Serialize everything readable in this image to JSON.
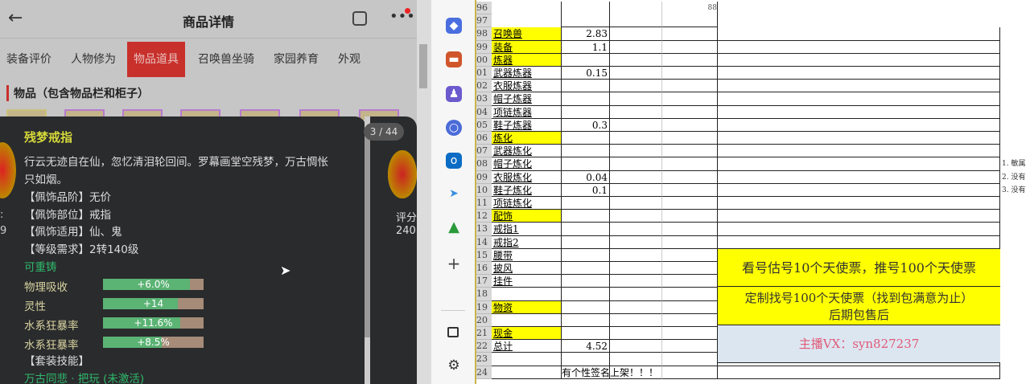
{
  "header": {
    "title": "商品详情",
    "back_icon": "arrow-left",
    "share_icon": "share",
    "more_icon": "more"
  },
  "tabs": [
    "装备评价",
    "人物修为",
    "物品道具",
    "召唤兽坐骑",
    "家园养育",
    "外观"
  ],
  "active_tab": 2,
  "section_title": "物品（包含物品栏和柜子）",
  "popup": {
    "name": "残梦戒指",
    "desc": [
      "行云无迹自在仙，忽忆清泪轮回间。罗幕画堂空残梦，万古惆怅",
      "只如烟。"
    ],
    "props": [
      "【佩饰品阶】无价",
      "【佩饰部位】戒指",
      "【佩饰适用】仙、鬼",
      "【等级需求】2转140级"
    ],
    "recast": "可重铸",
    "stats": [
      {
        "label": "物理吸收",
        "value": "+6.0%",
        "fill": 0.86
      },
      {
        "label": "灵性",
        "value": "+14",
        "fill": 0.74
      },
      {
        "label": "水系狂暴率",
        "value": "+11.6%",
        "fill": 0.77
      },
      {
        "label": "水系狂暴率",
        "value": "+8.5%",
        "fill": 0.58
      }
    ],
    "set_label": "【套装技能】",
    "set_name": "万古同悲 · 把玩 (未激活)",
    "counter": "3 / 44",
    "left_peek": [
      ":",
      "9"
    ],
    "right_peek": [
      "评分",
      "240"
    ]
  },
  "sidebar_icons": [
    "tag",
    "toolbox",
    "people",
    "copilot",
    "outlook",
    "send",
    "tree",
    "plus",
    "panel",
    "settings"
  ],
  "sheet": {
    "rows": [
      {
        "n": "96",
        "a": "",
        "b": "",
        "d": "88"
      },
      {
        "n": "97",
        "a": "",
        "b": ""
      },
      {
        "n": "98",
        "a": "召唤兽",
        "b": "2.83",
        "hl": true
      },
      {
        "n": "99",
        "a": "装备",
        "b": "1.1",
        "hl": true
      },
      {
        "n": "00",
        "a": "炼器",
        "b": "",
        "hl": true
      },
      {
        "n": "01",
        "a": "武器炼器",
        "b": "0.15"
      },
      {
        "n": "02",
        "a": "衣服炼器",
        "b": ""
      },
      {
        "n": "03",
        "a": "帽子炼器",
        "b": ""
      },
      {
        "n": "04",
        "a": "项链炼器",
        "b": ""
      },
      {
        "n": "05",
        "a": "鞋子炼器",
        "b": "0.3"
      },
      {
        "n": "06",
        "a": "炼化",
        "b": "",
        "hl": true
      },
      {
        "n": "07",
        "a": "武器炼化",
        "b": ""
      },
      {
        "n": "08",
        "a": "帽子炼化",
        "b": "",
        "f": "1. 敏属"
      },
      {
        "n": "09",
        "a": "衣服炼化",
        "b": "0.04",
        "f": "2. 没有"
      },
      {
        "n": "10",
        "a": "鞋子炼化",
        "b": "0.1",
        "f": "3. 没有"
      },
      {
        "n": "11",
        "a": "项链炼化",
        "b": ""
      },
      {
        "n": "12",
        "a": "配饰",
        "b": "",
        "hl": true
      },
      {
        "n": "13",
        "a": "戒指1",
        "b": ""
      },
      {
        "n": "14",
        "a": "戒指2",
        "b": ""
      },
      {
        "n": "15",
        "a": "腰带",
        "b": ""
      },
      {
        "n": "16",
        "a": "披风",
        "b": ""
      },
      {
        "n": "17",
        "a": "挂件",
        "b": ""
      },
      {
        "n": "18",
        "a": "",
        "b": ""
      },
      {
        "n": "19",
        "a": "物资",
        "b": "",
        "hl": true
      },
      {
        "n": "20",
        "a": "",
        "b": ""
      },
      {
        "n": "21",
        "a": "现金",
        "b": "",
        "hl": true
      },
      {
        "n": "22",
        "a": "总计",
        "b": "4.52"
      },
      {
        "n": "23",
        "a": "",
        "b": ""
      },
      {
        "n": "24",
        "a": "",
        "b": "有个性签名上架！！！"
      }
    ],
    "notice1": "看号估号10个天使票，推号100个天使票",
    "notice2_line1": "定制找号100个天使票（找到包满意为止）",
    "notice2_line2": "后期包售后",
    "contact": "主播VX：syn827237",
    "colors": {
      "highlight": "#ffff00",
      "contact_bg": "#dce6f1",
      "contact_text": "#e05a78"
    }
  }
}
